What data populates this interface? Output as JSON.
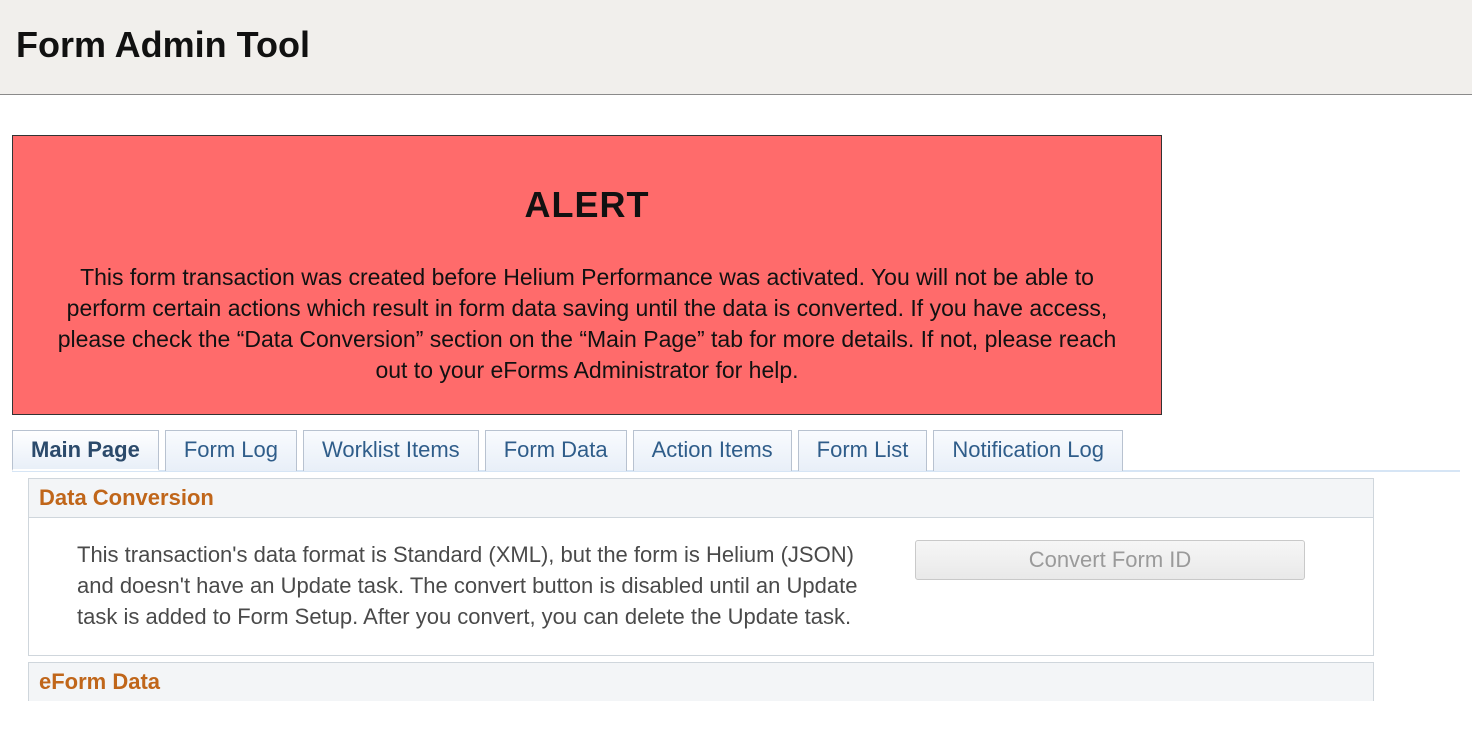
{
  "header": {
    "title": "Form Admin Tool"
  },
  "alert": {
    "title": "ALERT",
    "body": "This form transaction was created before Helium Performance was activated. You will not be able to perform certain actions which result in form data saving until the data is converted. If you have access, please check the “Data Conversion” section on the “Main Page” tab for more details. If not, please reach out to your eForms Administrator for help."
  },
  "tabs": [
    {
      "label": "Main Page",
      "active": true
    },
    {
      "label": "Form Log",
      "active": false
    },
    {
      "label": "Worklist Items",
      "active": false
    },
    {
      "label": "Form Data",
      "active": false
    },
    {
      "label": "Action Items",
      "active": false
    },
    {
      "label": "Form List",
      "active": false
    },
    {
      "label": "Notification Log",
      "active": false
    }
  ],
  "sections": {
    "dataConversion": {
      "title": "Data Conversion",
      "text": "This transaction's data format is Standard (XML), but the form is Helium (JSON) and doesn't have an Update task. The convert button is disabled until an Update task is added to Form Setup. After you convert, you can delete the Update task.",
      "buttonLabel": "Convert Form ID",
      "buttonEnabled": false
    },
    "eformData": {
      "title": "eForm Data"
    }
  }
}
